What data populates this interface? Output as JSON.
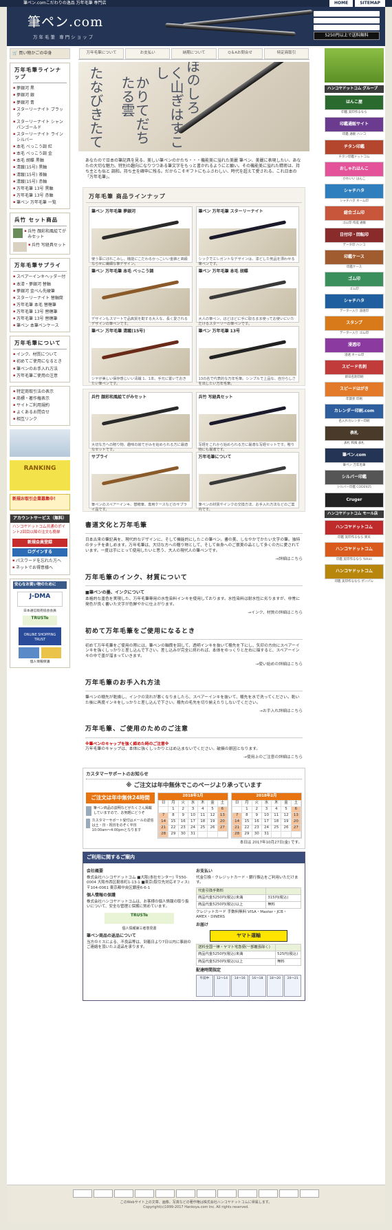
{
  "topbar": {
    "text": "筆ペン.comこだわりの逸品 万年毛筆 専門店",
    "home": "HOME",
    "sitemap": "SITEMAP"
  },
  "header": {
    "logo": "筆ペン.com",
    "tagline": "万年毛筆 専門ショップ",
    "count": "5250円以上で送料無料",
    "partner": "ハンコヤドットコム"
  },
  "nav": [
    "万年毛筆について",
    "お支払い",
    "納期について",
    "Q＆Aお問合せ",
    "特定商取引"
  ],
  "left": {
    "order": "買い物かごの中身",
    "lineup_head": "万年毛筆ラインナップ",
    "lineup": [
      "夢銀河 黒",
      "夢銀河 銀",
      "夢銀河 青",
      "スターリーナイト ブラック",
      "スターリーナイト シャンパンゴールド",
      "スターリーナイト ラインシルバー",
      "本毛 べっこう調 紅",
      "本毛 べっこう調 金",
      "本毛 胡蝶 黒軸",
      "清蹴(15号) 黒軸",
      "清蹴(15号) 茶軸",
      "清蹴(15号) 赤軸",
      "万年毛筆 13号 黒軸",
      "万年毛筆 13号 赤軸",
      "筆ペン 万年毛筆 一覧"
    ],
    "set_head": "兵竹 セット商品",
    "sets": [
      "兵竹 顔彩和風絵てがみセット",
      "兵竹 写経具セット"
    ],
    "supply_head": "万年毛筆サプライ",
    "supplies": [
      "スペアーインキヘッダー付",
      "本漆・夢銀河 替軸",
      "夢銀河 金べん先硬筆",
      "スターリーナイト 替軸筒",
      "万年毛筆 本毛 替穂筆",
      "万年毛筆 13号 替穂筆",
      "万年毛筆 13号 替穂筆",
      "筆ペン 本筆ペンケース"
    ],
    "about_head": "万年毛筆について",
    "about": [
      "インク、材質について",
      "初めてご使用になるとき",
      "筆ペンのお手入れ方法",
      "万年毛筆ご使用の注意"
    ],
    "info": [
      "特定商取引法の表示",
      "商標・著作権表示",
      "サイトご利用規約",
      "よくあるお問合せ",
      "相互リンク"
    ],
    "ranking": "RANKING",
    "newreg": "新規お取引企業募集中！",
    "account_head": "アカウントサービス（無料）",
    "account_text": "ハンコヤドットコム共通のポイント2回目以降の注文も簡単",
    "register": "新規会員登録",
    "login": "ログインする",
    "account_links": [
      "パスワードを忘れた方へ",
      "ネットでお得意様へ"
    ],
    "safe_head": "安心なお買い物のために",
    "safe": [
      "日本通信販売協会会員",
      "TRUSTe",
      "ONLINE SHOPPING TRUST",
      "JIPDEC",
      "個人情報保護"
    ]
  },
  "intro": "あなたので日本の筆記具を見る、美しい筆ペンのかたち・・・機能美に溢れた美麗 筆ペン、美麗に表現したい、あなたの大切な魅力。特別の趣向になりつつある筆文字をもっと書かれるようにと願い。その機能美に溢れた精密は、持ち主とも似と 調和。持ち主を確申に残る。だからこそギフトにもふさわしい、時代を超えて愛される、これ日本の「万年毛筆」。",
  "lineup": {
    "head": "万年毛筆 商品ラインナップ",
    "cards": [
      {
        "title": "筆ペン 万年毛筆 夢銀河",
        "desc": "使う事にほれこみし、機能にこだわるかっこいい金鋏と高級ならせに繊細な筆デザイン。"
      },
      {
        "title": "筆ペン 万年毛筆 スターリーナイト",
        "desc": "シックでエレガントなデザインは、漆どした気品を漂わせる筆ペンです。"
      },
      {
        "title": "筆ペン 万年毛筆 本毛 べっこう調",
        "desc": "デザインもスマートで品高質を勘する大人な、長く愛されるデザインの筆ペンです。"
      },
      {
        "title": "筆ペン 万年毛筆 本毛 胡蝶",
        "desc": "大人の筆ペン、ほどほどに手に取るまま使ってお使いにいただけるスターリーの筆ペンです。"
      },
      {
        "title": "筆ペン 万年毛筆 清蹴(15号)",
        "desc": "シヤが美しい保存感じいい清蹴 1、1本、手元に置いておきたい筆ペンです。"
      },
      {
        "title": "筆ペン 万年毛筆 13号",
        "desc": "13の名で代表的な万年毛筆。シンプルで上品な、自分らしさを出したい万年毛筆。"
      }
    ]
  },
  "sets": {
    "cards": [
      {
        "title": "兵竹 顔彩和風絵てがみセット",
        "desc": "大切な方への贈り物、趣味の絵てがみを始められる方に最適なセットです。"
      },
      {
        "title": "兵竹 写経具セット",
        "desc": "写経をこれから始められる方に最適な写経セットです。贈り物にも最適です。"
      },
      {
        "title": "サプライ",
        "desc": "筆ペンのスペアーインキ、替穂筆、専用ケースなどのサプライ品です。"
      },
      {
        "title": "万年毛筆について",
        "desc": "筆ペンの材質やインクの交換方法、お手入れ方法などのご案内です。"
      }
    ]
  },
  "articles": [
    {
      "head": "書道文化と万年毛筆",
      "body": "日本古来の筆記具を、現代的なデザインに、そして機能的にしたこの筆ペン。書の美、しなやかでかたい文字の筆。独特のタッチを楽しめます。万年毛筆は、大切な方への贈り物として、そして自身へのご褒美の品として多くの方に愛されています。一度は手にとって使用したいと思う、大人の現代人の筆ペンです。",
      "more": "→詳細はこちら"
    },
    {
      "head": "万年毛筆のインク、材質について",
      "sub": "■筆ペンの墨、インクについて",
      "body": "本格的な墨色を実現した、万年毛筆専用の水性染料インキを使用しております。水性染料は耐水性に劣りますが、非常に発色が良く書いた文字が色鮮やかに仕上がります。",
      "more": "→インク、材質の詳細はこちら"
    },
    {
      "head": "初めて万年毛筆をご使用になるとき",
      "body": "初めて万年毛筆をご使用の際には、筆ペンの軸筒を回して、透明インキを抜いて穂先を下にし、矢印の方向にスペアーインキを強くしっかりと差し込んで下さい。差し込みが完全に終われば、本体をゆっくりと左右に揺すると、スペアーインキの中で墨が溜まっていきます。",
      "more": "→使い始めの詳細はこちら"
    },
    {
      "head": "万年毛筆のお手入れ方法",
      "body": "筆ペンの穂先が乾燥し、インクの流れが悪くなりましたら、スペアーインキを抜いて、穂先を水で洗ってください。乾いた後に再度インキをしっかりと差し込んで下さい。穂先の毛先を切り揃えたりしないでください。",
      "more": "→お手入れ詳細はこちら"
    },
    {
      "head": "万年毛筆、ご使用のためのご注意",
      "warn": "※筆ペンのキャップを強く締めた時のご注意※",
      "body": "万年毛筆のキャップは、本体に強くしっかりとはめ込まないでください。破損の原因となります。",
      "more": "→使用上のご注意の詳細はこちら"
    }
  ],
  "support": {
    "head": "カスタマーサポートのお知らせ",
    "msg": "※ ご注文は年中無休でこのページより承っています",
    "banner": "ご注文は年中無休24時間",
    "note1": "筆ペン商品の説明などがたくさん掲載していますので、お気軽にどうぞ",
    "note2": "カスタマーサポート受付はメールの返信は土・日・祝日をのぞく平日10:00am〜4:00pmとなります",
    "cal1": "2018年1月",
    "cal2": "2018年2月",
    "today": "本日は 2017年10月27日(金) です。"
  },
  "guide": {
    "head": "ご利用に関するご案内",
    "company_head": "会社概要",
    "company": "株式会社ハンコヤドットコム ■大阪(本社センター) 〒550-0004 大阪市西区靭本町1-13-1 ■東京(取引先対応オフィス) 〒104-0061 東京都中央区銀座6-6-1",
    "privacy_head": "個人情報の保護",
    "privacy": "株式会社ハンコヤドットコムは、お客様の個人情報の取り扱いについて、安全な管理と保護に努めています。",
    "privacy_cert": "個人情報第三者意見書",
    "shipping_head": "筆ペン商品の返品について",
    "shipping": "当方のミスによる、不良品等は、到着日より7日以内に事前のご連絡を頂いた上返品を承ります。",
    "pay_head": "お支払い",
    "pay": "代金引換・クレジットカード・銀行振込をご利用いただけます。",
    "pay_table": [
      [
        "代金引換手数料",
        ""
      ],
      [
        "商品代金5250円(税込)未満",
        "315円(税込)"
      ],
      [
        "商品代金5250円(税込)以上",
        "無料"
      ]
    ],
    "credit": "クレジットカード 手数料無料 VISA・Master・JCB・AMEX・DINERS",
    "delivery_head": "お届け",
    "yamato": "ヤマト運輸",
    "ship_table": [
      [
        "送料全国一律・ヤマト宅急便(一部離島除く)",
        ""
      ],
      [
        "商品代金5250円(税込)未満",
        "525円(税込)"
      ],
      [
        "商品代金5250円(税込)以上",
        "無料"
      ]
    ],
    "time_head": "配達時間指定",
    "times": [
      "午前中",
      "12〜14",
      "14〜16",
      "16〜18",
      "18〜20",
      "20〜21"
    ]
  },
  "right": {
    "group_head": "ハンコヤドットコム グループ",
    "group_head2": "ハンコヤドットコム モール店",
    "banners": [
      {
        "label": "はんこ屋",
        "cap": "印鑑 実印作るなら",
        "color": "#2b6a2f"
      },
      {
        "label": "印鑑通販サイト",
        "cap": "印鑑 通販 ハンコ",
        "color": "#6b3b8f"
      },
      {
        "label": "チタン印鑑",
        "cap": "チタン印鑑ドットコム",
        "color": "#b5462e"
      },
      {
        "label": "おしゃれはんこ",
        "cap": "かわいい はんこ",
        "color": "#e4539a"
      },
      {
        "label": "シャチハタ",
        "cap": "シャチハタ ネーム印",
        "color": "#2f7fbf"
      },
      {
        "label": "総合ゴム印",
        "cap": "ゴム印 作成 通販",
        "color": "#c7563a"
      },
      {
        "label": "日付印・回転印",
        "cap": "データ印 ハンコ",
        "color": "#8a2b2b"
      },
      {
        "label": "印鑑ケース",
        "cap": "印鑑ケース",
        "color": "#a05b2e"
      },
      {
        "label": "ゴム印",
        "cap": "ゴム印",
        "color": "#3b8f5c"
      },
      {
        "label": "シャチハタ",
        "cap": "データー入り 浸透印",
        "color": "#1f5f9f"
      },
      {
        "label": "スタンプ",
        "cap": "データー入り ゴム印",
        "color": "#d97a1a"
      },
      {
        "label": "浸透印",
        "cap": "浸透 ネーム印",
        "color": "#8b3aa0"
      },
      {
        "label": "スピード名刺",
        "cap": "即日名刺印刷",
        "color": "#c23b3b"
      },
      {
        "label": "スピードはがき",
        "cap": "年賀状 印刷",
        "color": "#e37a2a"
      },
      {
        "label": "カレンダー印刷.com",
        "cap": "名入れカレンダー印刷",
        "color": "#2e5e9e"
      },
      {
        "label": "表札",
        "cap": "表札 和風 表札",
        "color": "#4a3a2a"
      },
      {
        "label": "筆ペン.com",
        "cap": "筆ペン 万年毛筆",
        "color": "#233455"
      },
      {
        "label": "シルバー印鑑",
        "cap": "シルバー印鑑 CODE925",
        "color": "#555555"
      },
      {
        "label": "Cruger",
        "cap": "",
        "color": "#222222"
      }
    ],
    "mall": [
      {
        "label": "ハンコヤドットコム",
        "cap": "印鑑 実印作るなら 楽天",
        "color": "#bf2a2a"
      },
      {
        "label": "ハンコヤドットコム",
        "cap": "印鑑 実印作るなら Yahoo",
        "color": "#d95a1a"
      },
      {
        "label": "ハンコヤドットコム",
        "cap": "印鑑 実印作るなら ポンパレ",
        "color": "#b8860b"
      }
    ]
  },
  "footer": {
    "copy": "このWebサイト上の文章、画像、写真などの著作権は株式会社ハンコヤドットコムに帰属します。",
    "copy2": "Copyright(c)1999-2017 Hankoya.com Inc. All rights reserved."
  }
}
